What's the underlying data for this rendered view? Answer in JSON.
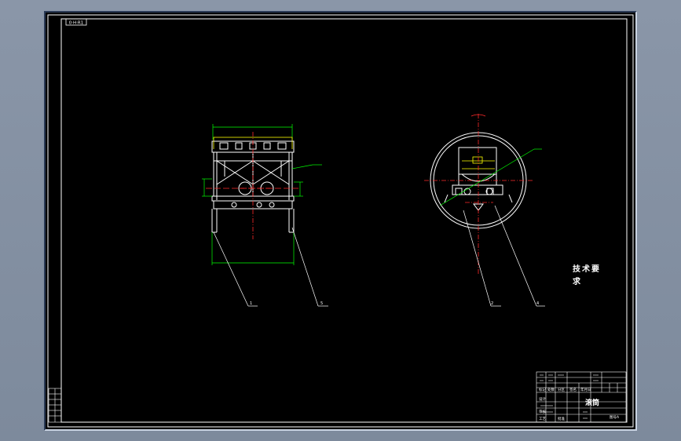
{
  "drawing": {
    "stamp_top_left": "0·H·R1",
    "side_view_balloons": [
      "1",
      "5"
    ],
    "section_view_balloons": [
      "2",
      "4"
    ],
    "tech_requirements": [
      "技术要",
      "求"
    ]
  },
  "title_block": {
    "name": "滚筒",
    "row_labels": [
      "标记",
      "处数",
      "分区",
      "签名",
      "年月日",
      "设计",
      "审核",
      "工艺",
      "批准"
    ],
    "bottom_right": "图号A"
  },
  "colors": {
    "frame": "#ffffff",
    "geometry": "#ffffff",
    "dimension": "#00ff00",
    "centerline": "#ff2a2a",
    "hidden": "#ffff00",
    "background": "#000000"
  }
}
